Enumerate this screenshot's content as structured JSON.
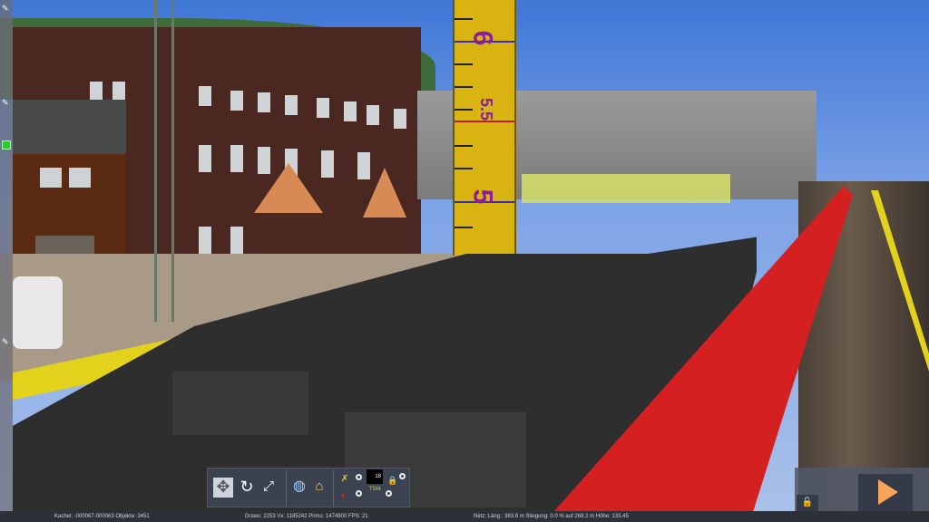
{
  "scene": {
    "ruler_labels": [
      "6",
      "5.5",
      "5"
    ]
  },
  "toolbar": {
    "buttons": [
      {
        "name": "fit-view-icon"
      },
      {
        "name": "rotate-icon"
      },
      {
        "name": "scale-icon"
      },
      {
        "name": "globe-icon"
      },
      {
        "name": "home-icon"
      }
    ],
    "counter_value": "18",
    "ts_label": "TSI4"
  },
  "statusbar": {
    "tile": "Kachel: -000067-000063  Objekte: 3451",
    "render": "Draws: 2253 Vx: 1185242 Prims: 1474900 FPS: 21",
    "net": "Netz:  Läng.:  383.8 m Steigung:  0.0 % auf 268.2 m Höhe: 133.45"
  },
  "colors": {
    "accent": "#f6a55a",
    "panel": "#343a48",
    "statusbar": "#2c3038"
  }
}
